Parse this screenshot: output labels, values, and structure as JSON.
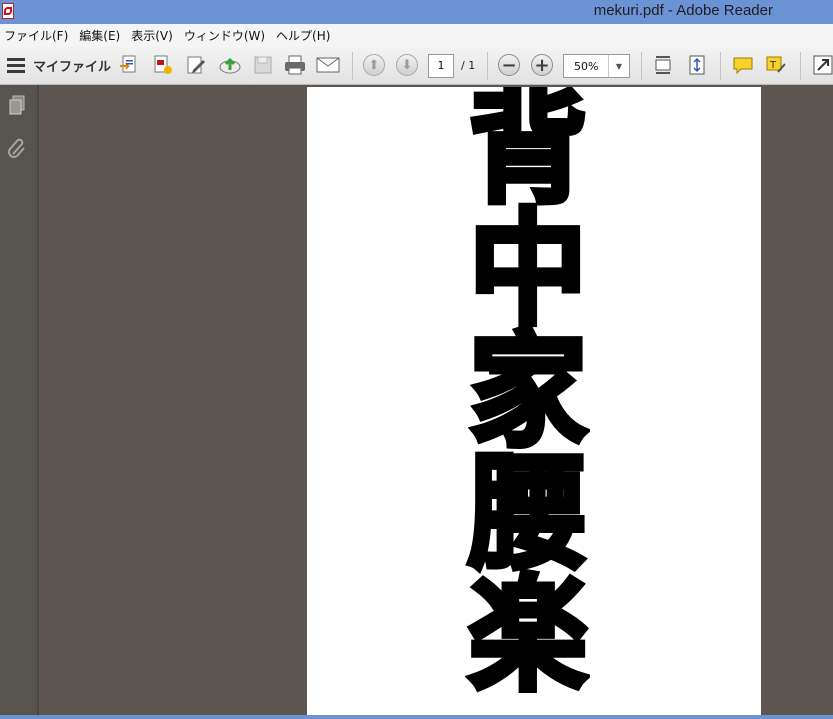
{
  "window": {
    "title": "mekuri.pdf - Adobe Reader"
  },
  "menu": {
    "items": [
      "ファイル(F)",
      "編集(E)",
      "表示(V)",
      "ウィンドウ(W)",
      "ヘルプ(H)"
    ]
  },
  "toolbar": {
    "my_files_label": "マイファイル",
    "page_current": "1",
    "page_total": "/ 1",
    "zoom_value": "50%",
    "icons": [
      "menu-icon",
      "create-pdf-icon",
      "convert-pdf-icon",
      "edit-icon",
      "upload-icon",
      "save-icon",
      "print-icon",
      "email-icon",
      "prev-page-icon",
      "next-page-icon",
      "zoom-out-icon",
      "zoom-in-icon",
      "fit-width-icon",
      "fit-page-icon",
      "comment-icon",
      "highlight-text-icon",
      "read-mode-icon"
    ]
  },
  "navpane": {
    "icons": [
      "pages-icon",
      "attachments-icon"
    ]
  },
  "document": {
    "characters": [
      "背",
      "中",
      "家",
      "腰",
      "楽"
    ]
  },
  "colors": {
    "titlebar": "#6c92d6",
    "workspace": "#5c5550",
    "page": "#ffffff"
  }
}
